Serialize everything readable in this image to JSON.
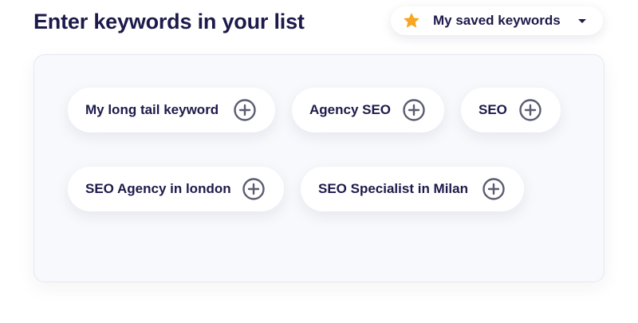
{
  "header": {
    "title": "Enter keywords in your list"
  },
  "saved_keywords": {
    "label": "My saved keywords",
    "icon": "star-icon",
    "caret_icon": "caret-down-icon",
    "star_color": "#f5a623"
  },
  "keywords": [
    {
      "label": "My long tail keyword"
    },
    {
      "label": "Agency SEO"
    },
    {
      "label": "SEO"
    },
    {
      "label": "SEO Agency in london"
    },
    {
      "label": "SEO Specialist in Milan"
    }
  ],
  "colors": {
    "text": "#1c1a4a",
    "plus_icon": "#5b5c72",
    "panel_bg": "#f7f9fc"
  }
}
